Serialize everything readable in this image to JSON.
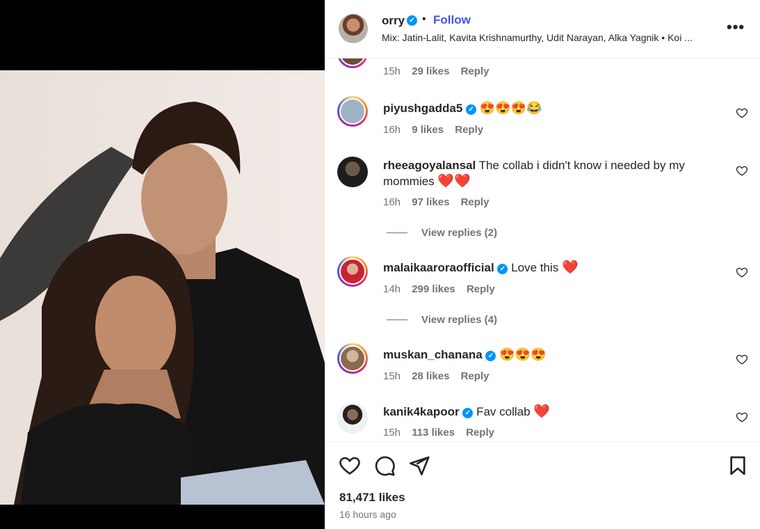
{
  "header": {
    "username": "orry",
    "dot": "•",
    "follow_label": "Follow",
    "music": "Mix: Jatin-Lalit, Kavita Krishnamurthy, Udit Narayan, Alka Yagnik • Koi ...",
    "more_label": "•••"
  },
  "comments": [
    {
      "username": "",
      "text": "",
      "time": "15h",
      "likes": "29 likes",
      "reply": "Reply"
    },
    {
      "username": "piyushgadda5",
      "text": "😍😍😍😂",
      "time": "16h",
      "likes": "9 likes",
      "reply": "Reply"
    },
    {
      "username": "rheeagoyalansal",
      "text": "The collab i didn't know i needed by my mommies",
      "emoji": "❤️❤️",
      "time": "16h",
      "likes": "97 likes",
      "reply": "Reply",
      "view_replies": "View replies (2)"
    },
    {
      "username": "malaikaaroraofficial",
      "text": "Love this",
      "emoji": "❤️",
      "time": "14h",
      "likes": "299 likes",
      "reply": "Reply",
      "view_replies": "View replies (4)"
    },
    {
      "username": "muskan_chanana",
      "text": "😍😍😍",
      "time": "15h",
      "likes": "28 likes",
      "reply": "Reply"
    },
    {
      "username": "kanik4kapoor",
      "text": "Fav collab",
      "emoji": "❤️",
      "time": "15h",
      "likes": "113 likes",
      "reply": "Reply"
    }
  ],
  "footer": {
    "likes": "81,471 likes",
    "time_ago": "16 hours ago"
  },
  "colors": {
    "follow": "#4150f7",
    "verified": "#0095f6",
    "secondary_text": "#737373"
  }
}
